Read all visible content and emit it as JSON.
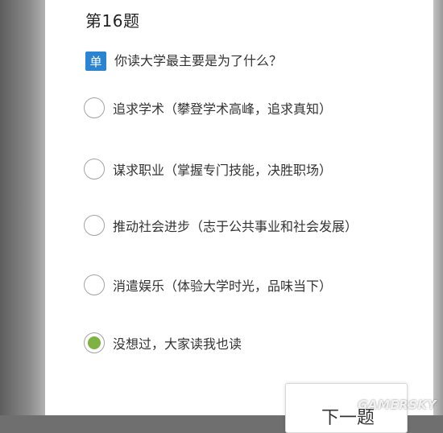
{
  "question": {
    "number_label": "第16题",
    "type_badge": "单",
    "text": "你读大学最主要是为了什么？"
  },
  "options": [
    {
      "label": "追求学术（攀登学术高峰，追求真知）",
      "selected": false
    },
    {
      "label": "谋求职业（掌握专门技能，决胜职场）",
      "selected": false
    },
    {
      "label": "推动社会进步（志于公共事业和社会发展）",
      "selected": false
    },
    {
      "label": "消遣娱乐（体验大学时光，品味当下）",
      "selected": false
    },
    {
      "label": "没想过，大家读我也读",
      "selected": true
    }
  ],
  "next_button": {
    "label": "下一题"
  },
  "watermark": "GAMERSKY",
  "colors": {
    "badge": "#2a84d1",
    "selected_radio": "#7cb342"
  }
}
